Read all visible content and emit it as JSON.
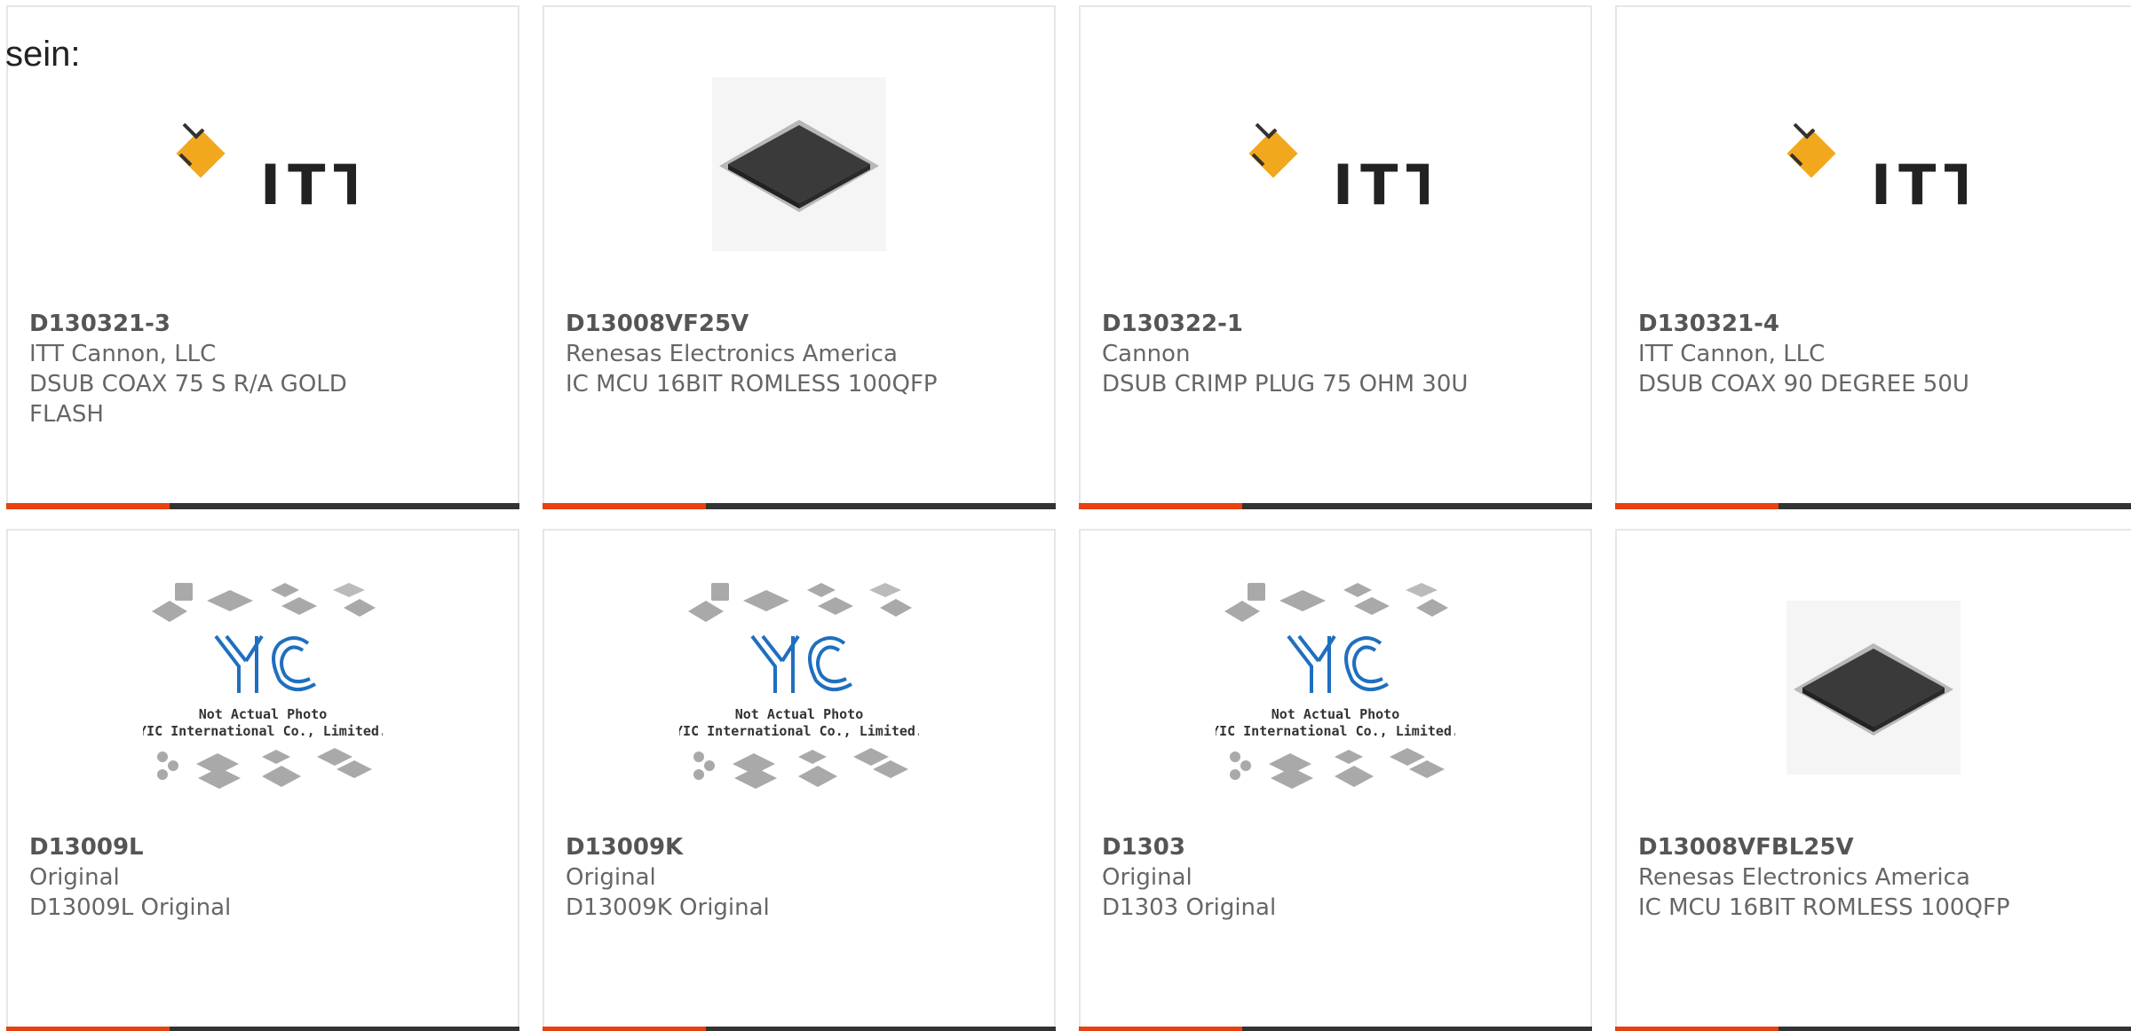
{
  "intro": {
    "text": "sein:"
  },
  "colors": {
    "accent": "#e8400f",
    "bar_dark": "#333333",
    "itt_orange": "#f2a81d",
    "yic_blue": "#1f6fbf"
  },
  "products": [
    {
      "part_number": "D130321-3",
      "manufacturer": "ITT Cannon, LLC",
      "description": "DSUB COAX 75 S R/A GOLD FLASH",
      "image": "itt-logo",
      "logo_text": "ITT"
    },
    {
      "part_number": "D13008VF25V",
      "manufacturer": "Renesas Electronics America",
      "description": "IC MCU 16BIT ROMLESS 100QFP",
      "image": "qfp-chip-photo"
    },
    {
      "part_number": "D130322-1",
      "manufacturer": "Cannon",
      "description": "DSUB CRIMP PLUG 75 OHM 30U",
      "image": "itt-logo",
      "logo_text": "ITT"
    },
    {
      "part_number": "D130321-4",
      "manufacturer": "ITT Cannon, LLC",
      "description": "DSUB COAX 90 DEGREE 50U",
      "image": "itt-logo",
      "logo_text": "ITT"
    },
    {
      "part_number": "D13009L",
      "manufacturer": "Original",
      "description": "D13009L Original",
      "image": "yic-placeholder",
      "placeholder_line1": "Not Actual Photo",
      "placeholder_line2": "YIC International Co., Limited."
    },
    {
      "part_number": "D13009K",
      "manufacturer": "Original",
      "description": "D13009K Original",
      "image": "yic-placeholder",
      "placeholder_line1": "Not Actual Photo",
      "placeholder_line2": "YIC International Co., Limited."
    },
    {
      "part_number": "D1303",
      "manufacturer": "Original",
      "description": "D1303 Original",
      "image": "yic-placeholder",
      "placeholder_line1": "Not Actual Photo",
      "placeholder_line2": "YIC International Co., Limited."
    },
    {
      "part_number": "D13008VFBL25V",
      "manufacturer": "Renesas Electronics America",
      "description": "IC MCU 16BIT ROMLESS 100QFP",
      "image": "qfp-chip-photo"
    }
  ]
}
